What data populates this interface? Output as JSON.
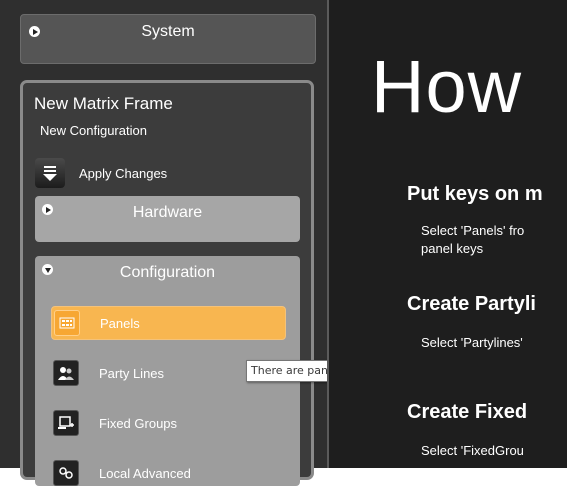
{
  "system": {
    "label": "System"
  },
  "matrix": {
    "title": "New Matrix Frame",
    "subtitle": "New Configuration",
    "apply_label": "Apply Changes"
  },
  "hardware": {
    "label": "Hardware"
  },
  "configuration": {
    "label": "Configuration",
    "items": [
      {
        "label": "Panels",
        "active": true
      },
      {
        "label": "Party Lines",
        "active": false
      },
      {
        "label": "Fixed Groups",
        "active": false
      },
      {
        "label": "Local Advanced",
        "active": false
      }
    ]
  },
  "tooltip": {
    "text": "There are panels configured, but no keys."
  },
  "content": {
    "heading": "How",
    "sections": [
      {
        "title": "Put keys on m",
        "text_lines": [
          "Select 'Panels' fro",
          "panel keys"
        ]
      },
      {
        "title": "Create Partyli",
        "text_lines": [
          "Select 'Partylines'"
        ]
      },
      {
        "title": "Create Fixed",
        "text_lines": [
          "Select 'FixedGrou"
        ]
      }
    ]
  },
  "colors": {
    "active_item": "#f8b650",
    "group_background": "#9d9d9d",
    "content_background": "#1e1e1e"
  }
}
